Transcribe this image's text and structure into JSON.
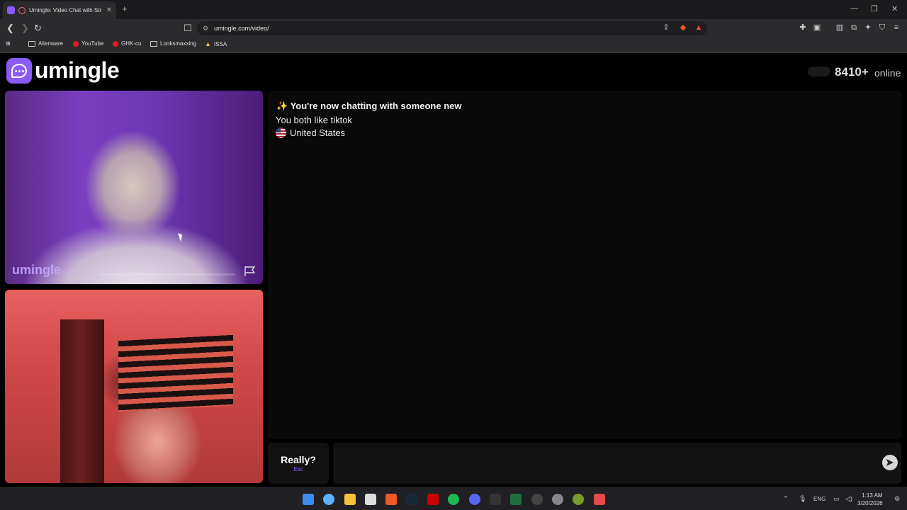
{
  "browser": {
    "tab_title": "Umingle: Video Chat with Str",
    "tab_close": "✕",
    "new_tab": "+",
    "url": "umingle.com/video/",
    "bookmarks": [
      "Alienware",
      "YouTube",
      "GHK-cu",
      "Looksmaxxing",
      "ISSA"
    ]
  },
  "header": {
    "brand": "umingle",
    "online_count": "8410+",
    "online_label": "online"
  },
  "stranger_video": {
    "watermark": "umingle",
    "watermark_suffix": ".com"
  },
  "chat": {
    "system_new_match": "✨ You're now chatting with someone new",
    "system_common_interest": "You both like tiktok",
    "country": "United States"
  },
  "controls": {
    "skip_label": "Really?",
    "skip_hint": "Esc",
    "message_placeholder": ""
  },
  "taskbar": {
    "lang": "ENG",
    "time": "1:13 AM",
    "date": "3/20/2026"
  },
  "colors": {
    "brand_purple": "#8a5cf6"
  }
}
